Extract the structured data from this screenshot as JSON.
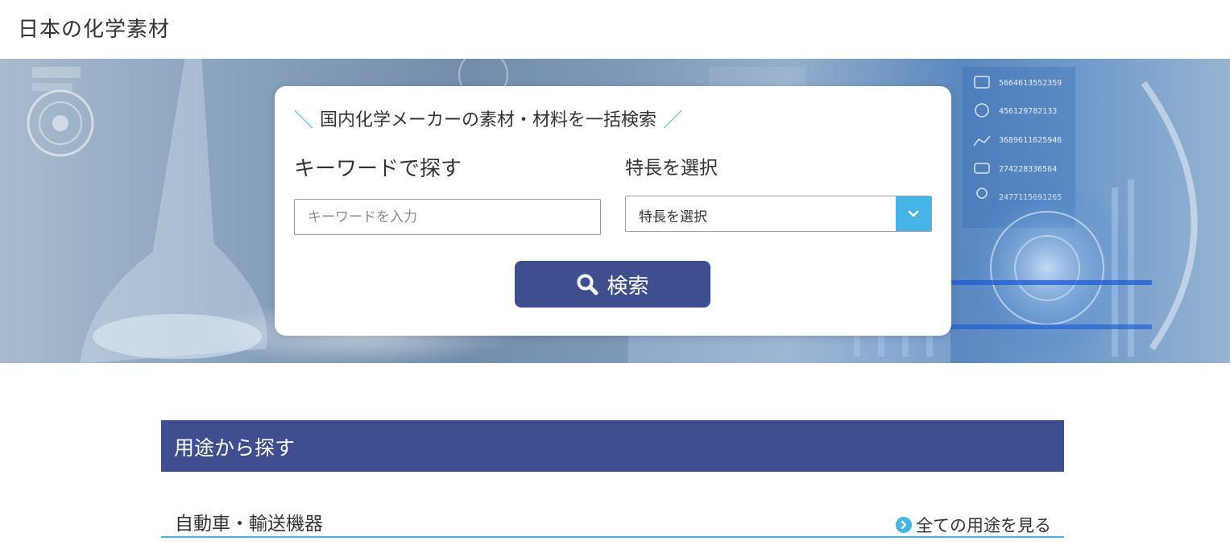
{
  "header": {
    "site_title": "日本の化学素材"
  },
  "search": {
    "heading": "国内化学メーカーの素材・材料を一括検索",
    "keyword_label": "キーワードで探す",
    "keyword_placeholder": "キーワードを入力",
    "feature_label": "特長を選択",
    "feature_selected": "特長を選択",
    "search_button": "検索"
  },
  "usage_section": {
    "title": "用途から探す",
    "category": "自動車・輸送機器",
    "see_all": "全ての用途を見る"
  },
  "hero_overlay": {
    "data_numbers": [
      "5664613552359",
      "456129782133",
      "3689611625946",
      "274228336564",
      "2477115691265"
    ]
  },
  "colors": {
    "primary_navy": "#3e4e8f",
    "accent_cyan": "#45b4e6",
    "text": "#333333"
  },
  "icons": {
    "search": "search-icon",
    "dropdown": "chevron-down-icon",
    "see_all": "chevron-right-circle-icon"
  }
}
